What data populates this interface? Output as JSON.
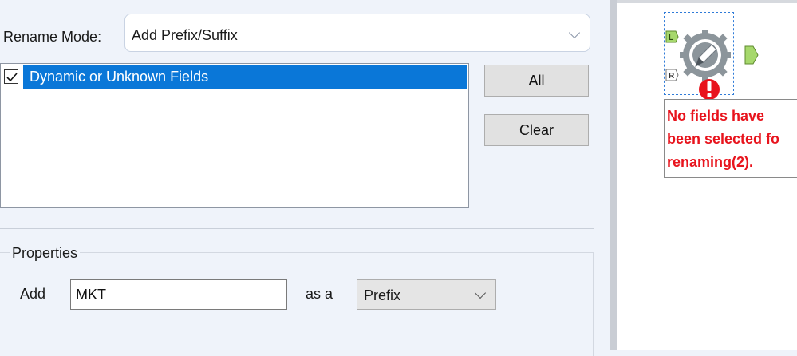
{
  "rename": {
    "label": "Rename Mode:",
    "value": "Add Prefix/Suffix"
  },
  "fields": [
    {
      "label": "Dynamic or Unknown Fields",
      "checked": true,
      "selected": true
    }
  ],
  "buttons": {
    "all": "All",
    "clear": "Clear"
  },
  "properties": {
    "title": "Properties",
    "add_label": "Add",
    "add_value": "MKT",
    "as_label": "as a",
    "position_value": "Prefix"
  },
  "canvas": {
    "anchor_left": "L",
    "anchor_right": "R",
    "error_message": "No fields have\nbeen selected fo\nrenaming(2)."
  },
  "colors": {
    "selection": "#0a77d8",
    "error": "#e8141d",
    "tool_gear": "#8c959b",
    "anchor_green": "#a6d86c"
  }
}
